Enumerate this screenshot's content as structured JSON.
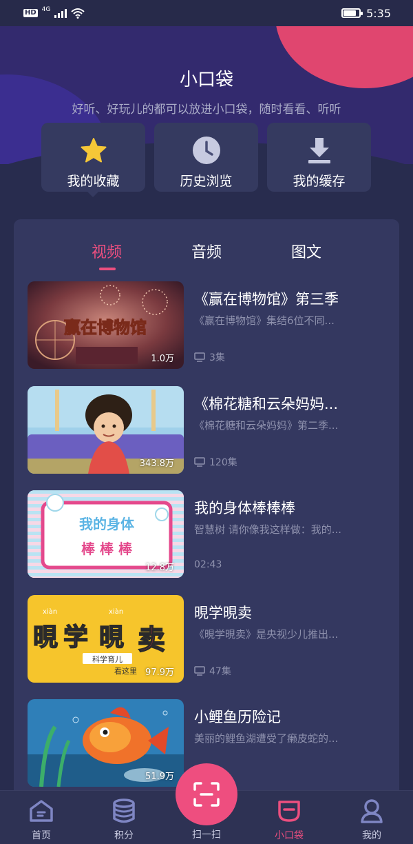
{
  "status_bar": {
    "hd": "HD",
    "network": "4G",
    "time": "5:35",
    "battery_level": 0.8
  },
  "header": {
    "title": "小口袋",
    "subtitle": "好听、好玩儿的都可以放进小口袋，随时看看、听听"
  },
  "quick_actions": [
    {
      "label": "我的收藏",
      "icon": "star-icon"
    },
    {
      "label": "历史浏览",
      "icon": "clock-icon"
    },
    {
      "label": "我的缓存",
      "icon": "download-icon"
    }
  ],
  "tabs": [
    {
      "label": "视频",
      "active": true
    },
    {
      "label": "音频",
      "active": false
    },
    {
      "label": "图文",
      "active": false
    }
  ],
  "videos": [
    {
      "title": "《赢在博物馆》第三季",
      "desc": "《赢在博物馆》集结6位不同...",
      "count": "1.0万",
      "meta": "3集",
      "meta_icon": "episodes-icon",
      "thumb_text": "赢在博物馆"
    },
    {
      "title": "《棉花糖和云朵妈妈...",
      "desc": "《棉花糖和云朵妈妈》第二季...",
      "count": "343.8万",
      "meta": "120集",
      "meta_icon": "episodes-icon",
      "thumb_text": ""
    },
    {
      "title": "我的身体棒棒棒",
      "desc": "智慧树 请你像我这样做：我的...",
      "count": "12.8万",
      "meta": "02:43",
      "meta_icon": "",
      "thumb_text": "我的身体棒棒棒"
    },
    {
      "title": "晛学晛卖",
      "desc": "《晛学晛卖》是央视少儿推出...",
      "count": "97.9万",
      "meta": "47集",
      "meta_icon": "episodes-icon",
      "thumb_text": "晛学晛卖",
      "thumb_pinyin": "xiàn",
      "thumb_sub": "科学育儿",
      "thumb_sub2": "看这里"
    },
    {
      "title": "小鲤鱼历险记",
      "desc": "美丽的鲤鱼湖遭受了癞皮蛇的...",
      "count": "51.9万",
      "meta": "",
      "meta_icon": "",
      "thumb_text": ""
    }
  ],
  "bottom_nav": [
    {
      "label": "首页",
      "icon": "home-icon",
      "active": false
    },
    {
      "label": "积分",
      "icon": "coins-icon",
      "active": false
    },
    {
      "label": "扫一扫",
      "icon": "scan-icon",
      "active": false
    },
    {
      "label": "小口袋",
      "icon": "pocket-icon",
      "active": true
    },
    {
      "label": "我的",
      "icon": "profile-icon",
      "active": false
    }
  ],
  "colors": {
    "accent": "#ec4f7f",
    "background": "#282c4e",
    "panel": "#343860",
    "card": "#353a60"
  }
}
